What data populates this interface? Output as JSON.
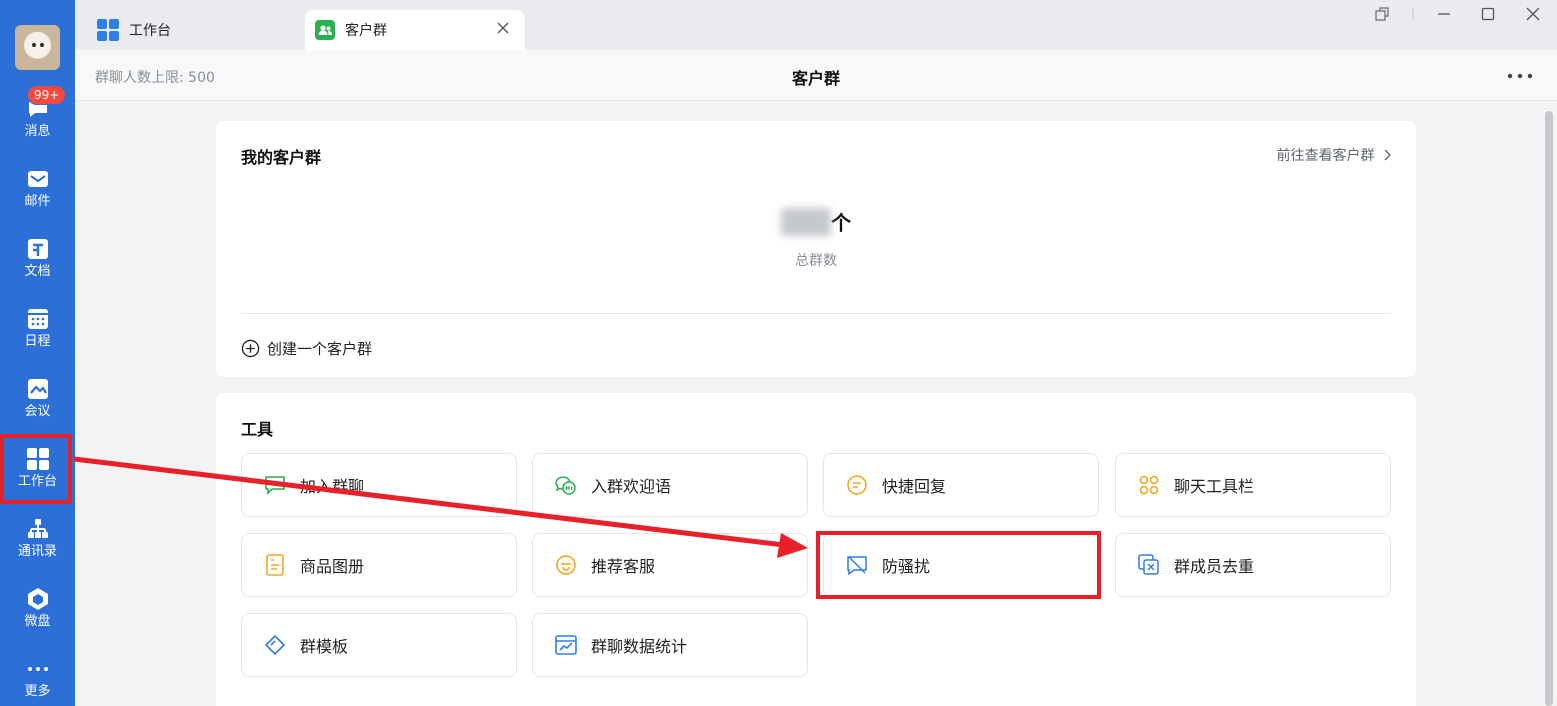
{
  "sidebar": {
    "items": [
      {
        "label": "消息",
        "icon": "chat-bubble-icon",
        "badge": "99+"
      },
      {
        "label": "邮件",
        "icon": "mail-icon"
      },
      {
        "label": "文档",
        "icon": "document-icon"
      },
      {
        "label": "日程",
        "icon": "calendar-icon"
      },
      {
        "label": "会议",
        "icon": "meeting-icon"
      },
      {
        "label": "工作台",
        "icon": "workbench-grid-icon"
      },
      {
        "label": "通讯录",
        "icon": "org-chart-icon"
      },
      {
        "label": "微盘",
        "icon": "cloud-disk-icon"
      },
      {
        "label": "更多",
        "icon": "more-dots-icon"
      }
    ]
  },
  "tabs": [
    {
      "label": "工作台",
      "icon": "workbench-grid-icon",
      "active": false
    },
    {
      "label": "客户群",
      "icon": "customer-group-icon",
      "active": true
    }
  ],
  "header": {
    "limit_text": "群聊人数上限: 500",
    "title": "客户群"
  },
  "my_groups": {
    "title": "我的客户群",
    "view_link": "前往查看客户群",
    "count_unit": "个",
    "count_label": "总群数",
    "create_label": "创建一个客户群"
  },
  "tools": {
    "title": "工具",
    "items": [
      {
        "label": "加入群聊",
        "icon": "join-chat-icon"
      },
      {
        "label": "入群欢迎语",
        "icon": "welcome-message-icon"
      },
      {
        "label": "快捷回复",
        "icon": "quick-reply-icon"
      },
      {
        "label": "聊天工具栏",
        "icon": "chat-toolbar-icon"
      },
      {
        "label": "商品图册",
        "icon": "product-album-icon"
      },
      {
        "label": "推荐客服",
        "icon": "recommend-service-icon"
      },
      {
        "label": "防骚扰",
        "icon": "anti-harassment-icon"
      },
      {
        "label": "群成员去重",
        "icon": "dedupe-members-icon"
      },
      {
        "label": "群模板",
        "icon": "group-template-icon"
      },
      {
        "label": "群聊数据统计",
        "icon": "chat-statistics-icon"
      }
    ]
  },
  "colors": {
    "sidebar": "#2b6fd7",
    "highlight": "#e8202a",
    "accent_green": "#28b24c",
    "accent_orange": "#f0a821",
    "accent_blue": "#2f7ee8"
  }
}
